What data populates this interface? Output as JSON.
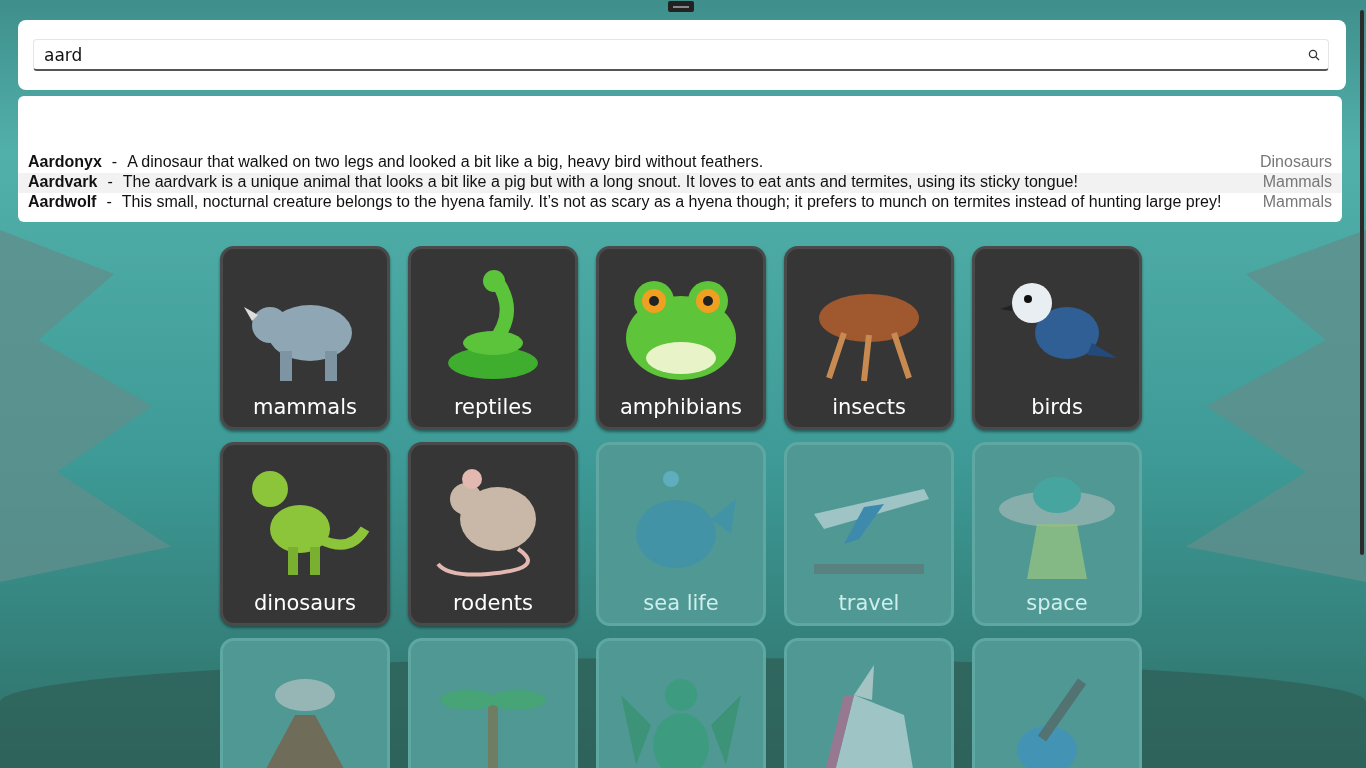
{
  "search": {
    "value": "aard"
  },
  "results": [
    {
      "name": "Aardonyx",
      "separator": "-",
      "description": "A dinosaur that walked on two legs and looked a bit like a big, heavy bird without feathers.",
      "category": "Dinosaurs",
      "selected": false
    },
    {
      "name": "Aardvark",
      "separator": "-",
      "description": "The aardvark is a unique animal that looks a bit like a pig but with a long snout. It loves to eat ants and termites, using its sticky tongue!",
      "category": "Mammals",
      "selected": true
    },
    {
      "name": "Aardwolf",
      "separator": "-",
      "description": "This small, nocturnal creature belongs to the hyena family. It’s not as scary as a hyena though; it prefers to munch on termites instead of hunting large prey!",
      "category": "Mammals",
      "selected": false
    }
  ],
  "tiles": [
    {
      "label": "mammals",
      "disabled": false
    },
    {
      "label": "reptiles",
      "disabled": false
    },
    {
      "label": "amphibians",
      "disabled": false
    },
    {
      "label": "insects",
      "disabled": false
    },
    {
      "label": "birds",
      "disabled": false
    },
    {
      "label": "dinosaurs",
      "disabled": false
    },
    {
      "label": "rodents",
      "disabled": false
    },
    {
      "label": "sea life",
      "disabled": true
    },
    {
      "label": "travel",
      "disabled": true
    },
    {
      "label": "space",
      "disabled": true
    },
    {
      "disabled": true
    },
    {
      "disabled": true
    },
    {
      "disabled": true
    },
    {
      "disabled": true
    },
    {
      "disabled": true
    }
  ]
}
